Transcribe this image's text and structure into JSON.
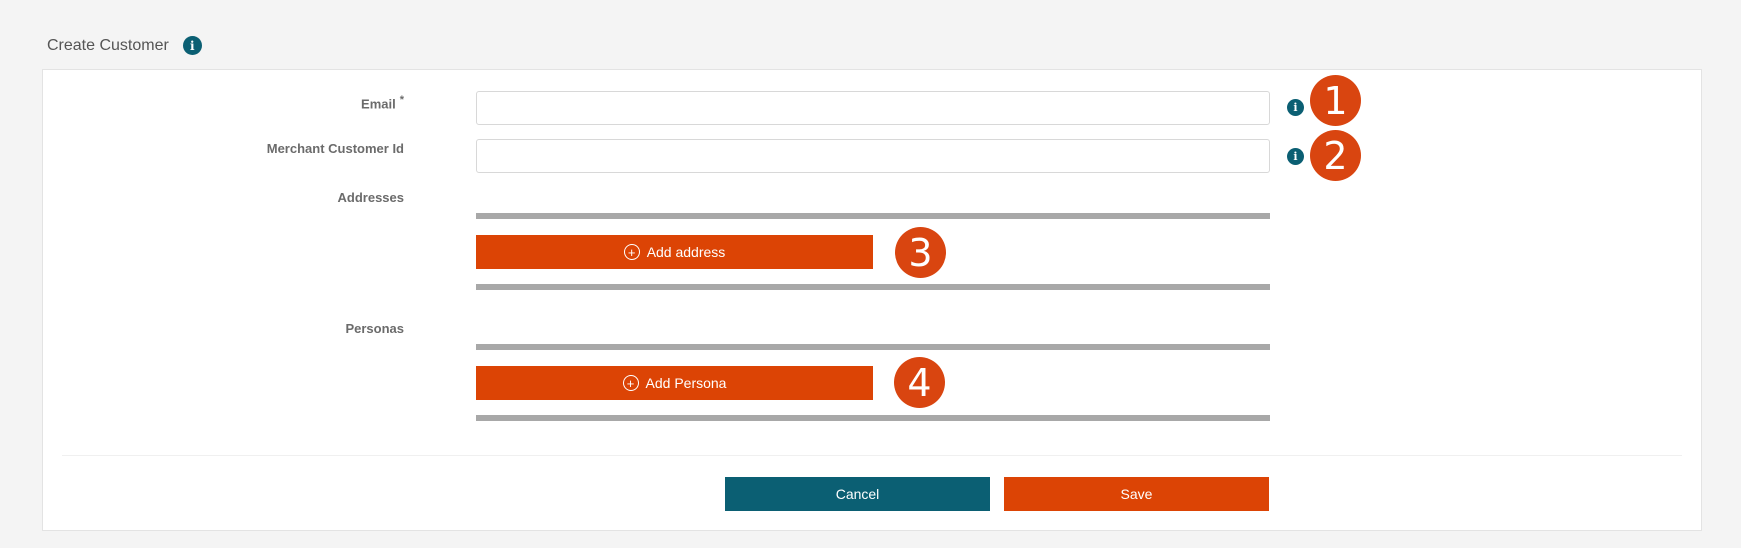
{
  "header": {
    "title": "Create Customer",
    "info_icon": "info-icon"
  },
  "form": {
    "email": {
      "label": "Email",
      "required_marker": "*",
      "value": "",
      "placeholder": ""
    },
    "merchant_customer_id": {
      "label": "Merchant Customer Id",
      "value": "",
      "placeholder": ""
    },
    "addresses": {
      "label": "Addresses",
      "add_button": "Add address"
    },
    "personas": {
      "label": "Personas",
      "add_button": "Add Persona"
    }
  },
  "callouts": [
    "1",
    "2",
    "3",
    "4"
  ],
  "actions": {
    "cancel": "Cancel",
    "save": "Save"
  },
  "colors": {
    "accent": "#dc4405",
    "primary_dark": "#0b5f73",
    "rule_gray": "#a8a8a8"
  }
}
